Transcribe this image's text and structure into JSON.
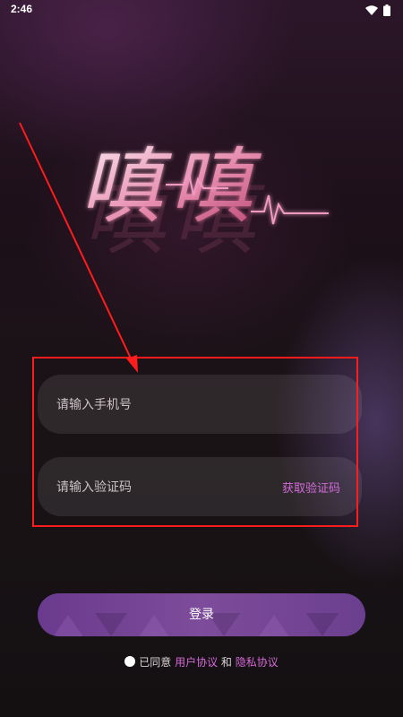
{
  "status_bar": {
    "time": "2:46"
  },
  "logo": {
    "text": "嗔嗔"
  },
  "form": {
    "phone": {
      "placeholder": "请输入手机号",
      "value": ""
    },
    "code": {
      "placeholder": "请输入验证码",
      "value": "",
      "get_code_label": "获取验证码"
    }
  },
  "login_button": {
    "label": "登录"
  },
  "agreement": {
    "checked": false,
    "prefix": "已同意",
    "user_agreement": "用户协议",
    "and": "和",
    "privacy_policy": "隐私协议"
  },
  "colors": {
    "accent": "#d46bd7",
    "button": "#7d4c9a",
    "annotation": "#ff1c1c"
  }
}
